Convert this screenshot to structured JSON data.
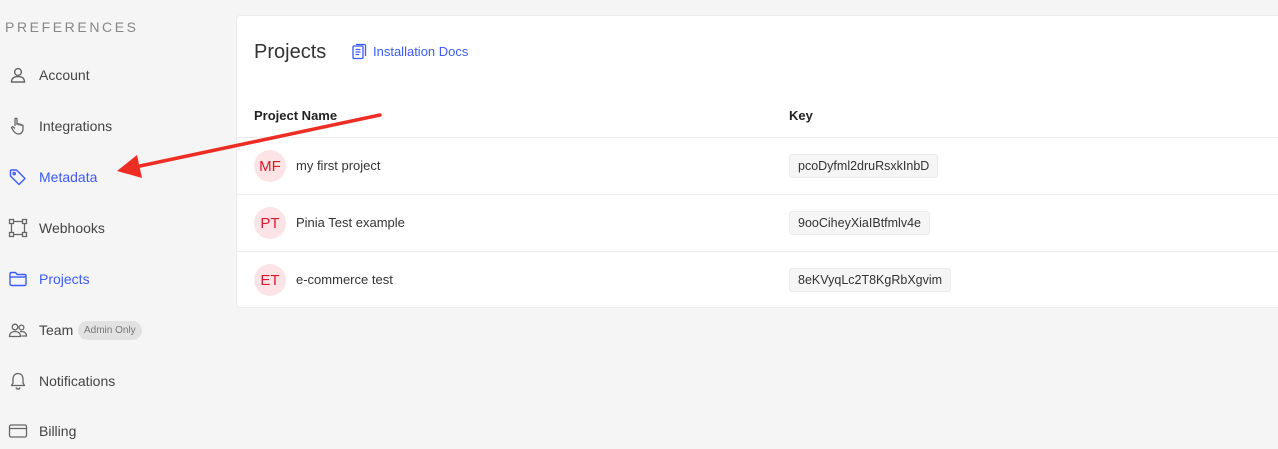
{
  "sidebar": {
    "heading": "PREFERENCES",
    "items": [
      {
        "label": "Account",
        "icon": "user-icon"
      },
      {
        "label": "Integrations",
        "icon": "pointer-hand-icon"
      },
      {
        "label": "Metadata",
        "icon": "tag-icon"
      },
      {
        "label": "Webhooks",
        "icon": "webhook-icon"
      },
      {
        "label": "Projects",
        "icon": "folder-icon"
      },
      {
        "label": "Team",
        "icon": "team-icon",
        "badge": "Admin Only"
      },
      {
        "label": "Notifications",
        "icon": "bell-icon"
      },
      {
        "label": "Billing",
        "icon": "credit-card-icon"
      }
    ],
    "active_label": "Metadata, Projects",
    "accent_color": "#3d5afe"
  },
  "main": {
    "title": "Projects",
    "docs_link": "Installation Docs",
    "table": {
      "headers": [
        "Project Name",
        "Key"
      ],
      "rows": [
        {
          "initials": "MF",
          "name": "my first project",
          "key": "pcoDyfml2druRsxkInbD"
        },
        {
          "initials": "PT",
          "name": "Pinia Test example",
          "key": "9ooCiheyXiaIBtfmlv4e"
        },
        {
          "initials": "ET",
          "name": "e-commerce test",
          "key": "8eKVyqLc2T8KgRbXgvim"
        }
      ]
    }
  },
  "annotation": {
    "type": "arrow",
    "color": "#ee2d24",
    "points_to": "sidebar-item-metadata"
  }
}
